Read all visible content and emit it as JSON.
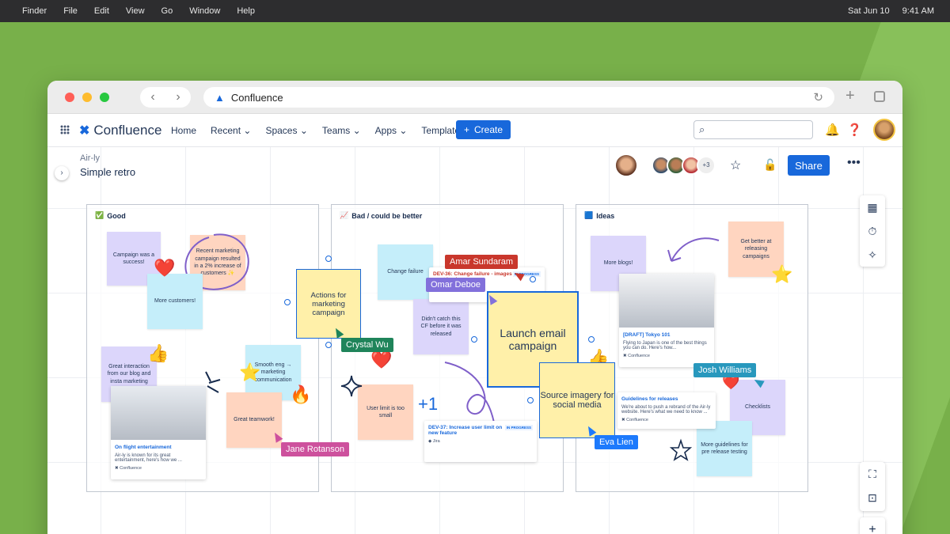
{
  "menubar": {
    "items": [
      "Finder",
      "File",
      "Edit",
      "View",
      "Go",
      "Window",
      "Help"
    ],
    "date": "Sat Jun 10",
    "time": "9:41 AM"
  },
  "browser": {
    "url_title": "Confluence"
  },
  "topnav": {
    "brand": "Confluence",
    "menu": [
      "Home",
      "Recent",
      "Spaces",
      "Teams",
      "Apps",
      "Templates"
    ],
    "create_label": "Create"
  },
  "page": {
    "breadcrumb": "Air-ly",
    "title": "Simple retro",
    "collaborators_more": "+3",
    "share_label": "Share"
  },
  "columns": [
    {
      "emoji": "✅",
      "title": "Good"
    },
    {
      "emoji": "📈",
      "title": "Bad / could be better"
    },
    {
      "emoji": "🟦",
      "title": "Ideas"
    }
  ],
  "good": {
    "sticky1": "Campaign was a success!",
    "sticky2": "Recent marketing campaign resulted in a 2% increase of customers ✨",
    "sticky3": "More customers!",
    "sticky4": "Great interaction from our blog and insta marketing",
    "sticky5": "Smooth eng → marketing communication",
    "sticky6": "Great teamwork!",
    "card_title": "On flight entertainment",
    "card_text": "Air-ly is known for its great entertainment, here's how we ...",
    "card_source": "Confluence"
  },
  "bad": {
    "sticky1": "Change failure",
    "sticky2": "Didn't catch this CF before it was released",
    "sticky3": "User limit is too small",
    "card1_title": "DEV-36: Change failure - images wont load",
    "card1_status": "IN PROGRESS",
    "card2_title": "DEV-37: Increase user limit on new feature",
    "card2_status": "IN PROGRESS",
    "card_source": "Jira"
  },
  "ideas": {
    "sticky1": "More blogs!",
    "sticky2": "Get better at releasing campaigns",
    "sticky3": "Checklists",
    "sticky4": "More guidelines for pre release testing",
    "card1_title": "[DRAFT] Tokyo 101",
    "card1_text": "Flying to Japan is one of the best things you can do. Here's how...",
    "card1_source": "Confluence",
    "card2_title": "Guidelines for releases",
    "card2_text": "We're about to push a rebrand of the Air-ly website. Here's what we need to know ...",
    "card2_source": "Confluence"
  },
  "floating": {
    "actions_note": "Actions for marketing campaign",
    "launch_note": "Launch email campaign",
    "source_note": "Source imagery for social media"
  },
  "cursors": [
    {
      "name": "Amar Sundaram",
      "color": "#c9372c"
    },
    {
      "name": "Omar Deboe",
      "color": "#8270db"
    },
    {
      "name": "Crystal Wu",
      "color": "#1f845a"
    },
    {
      "name": "Jane Rotanson",
      "color": "#cd519d"
    },
    {
      "name": "Josh Williams",
      "color": "#2898bd"
    },
    {
      "name": "Eva Lien",
      "color": "#1d7afc"
    }
  ]
}
